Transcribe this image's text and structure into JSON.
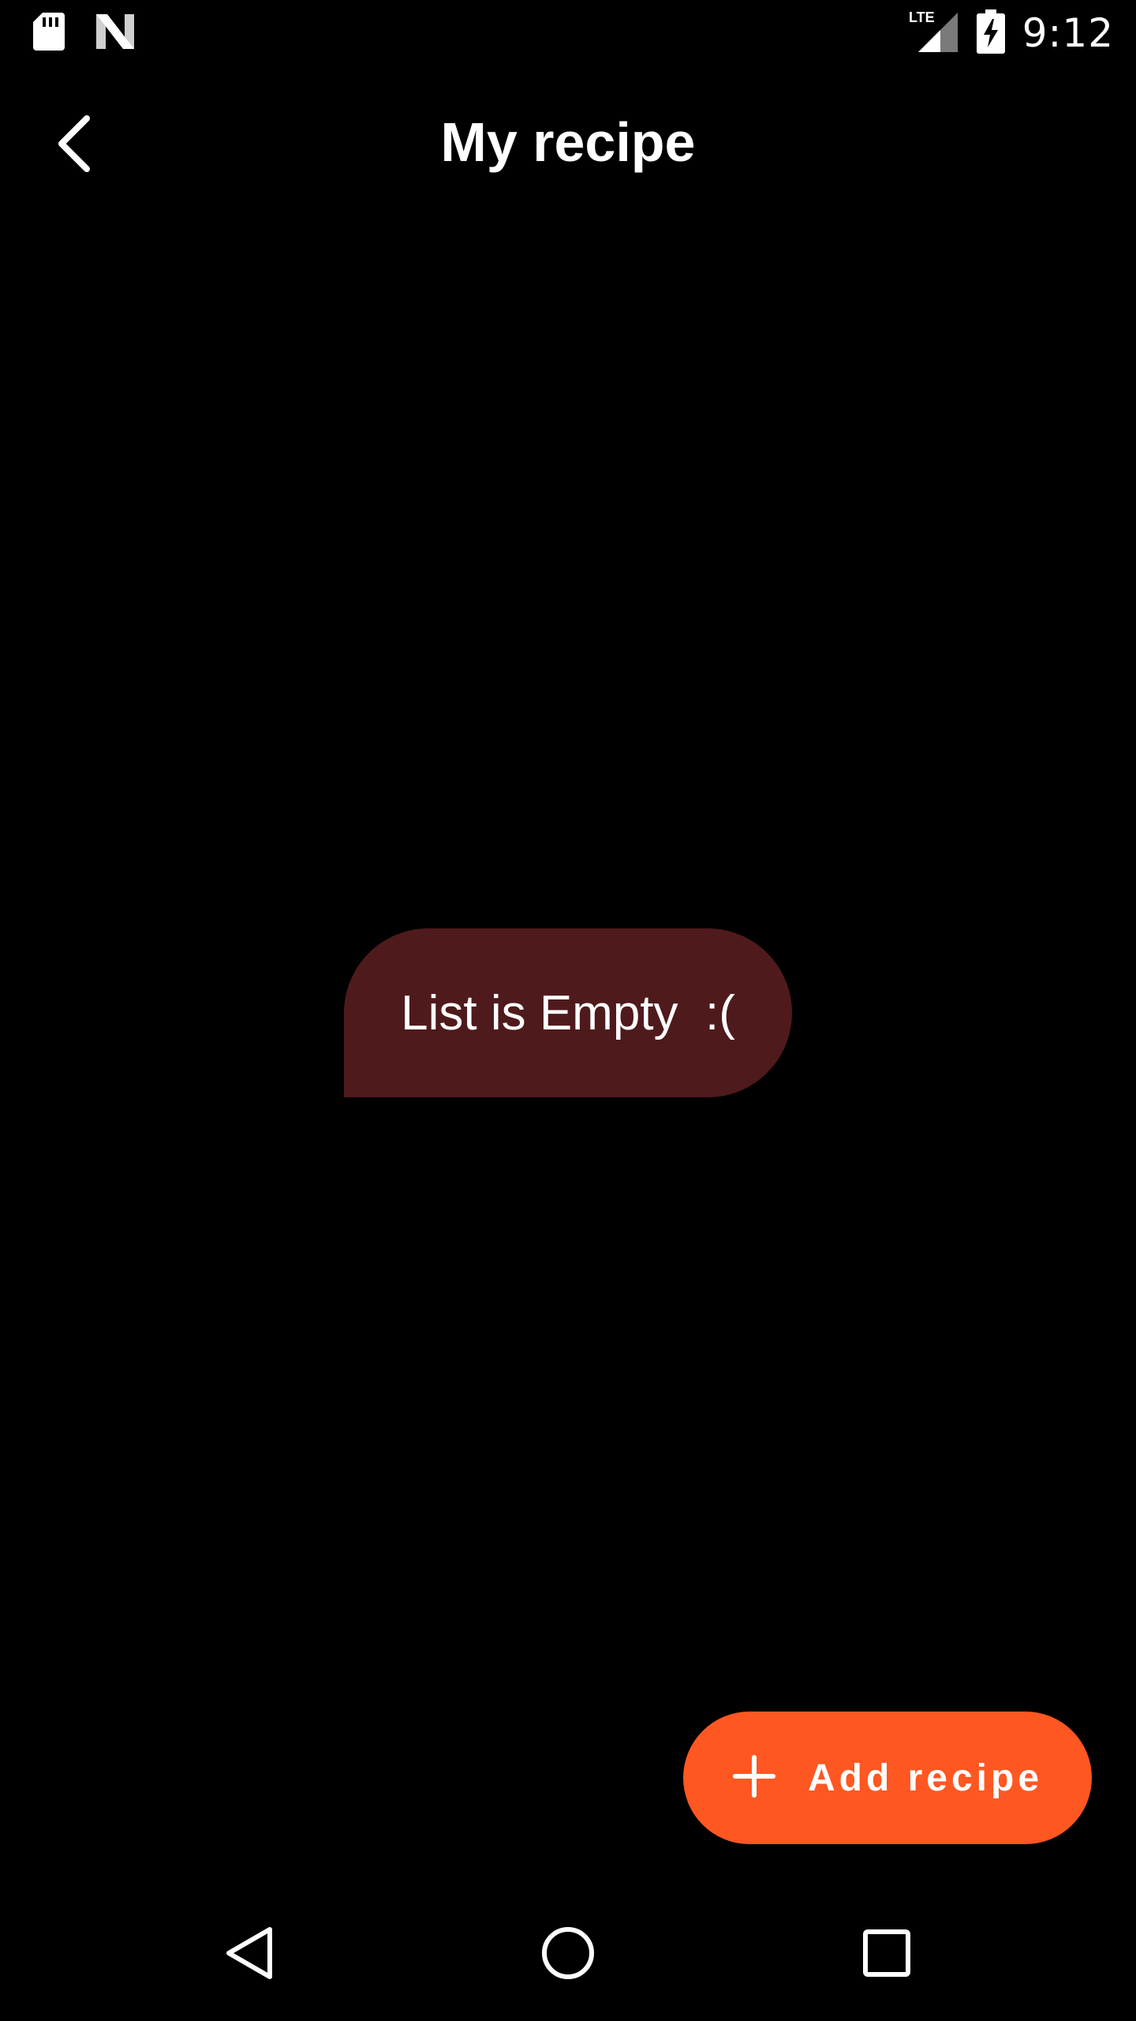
{
  "status_bar": {
    "time": "9:12",
    "network": "LTE",
    "left_icons": [
      "sd-card-icon",
      "n-logo-icon"
    ],
    "right_icons": [
      "lte-signal-icon",
      "battery-charging-icon"
    ]
  },
  "toolbar": {
    "title": "My recipe",
    "back_icon": "chevron-left-icon"
  },
  "empty_state": {
    "message": "List is Empty  :("
  },
  "fab": {
    "label": "Add recipe",
    "icon": "plus-icon"
  },
  "nav_bar": {
    "buttons": [
      "back-triangle-icon",
      "home-circle-icon",
      "recents-square-icon"
    ]
  },
  "colors": {
    "background": "#000000",
    "accent": "#ff5722",
    "bubble": "#4f1a1c",
    "text": "#ffffff"
  }
}
